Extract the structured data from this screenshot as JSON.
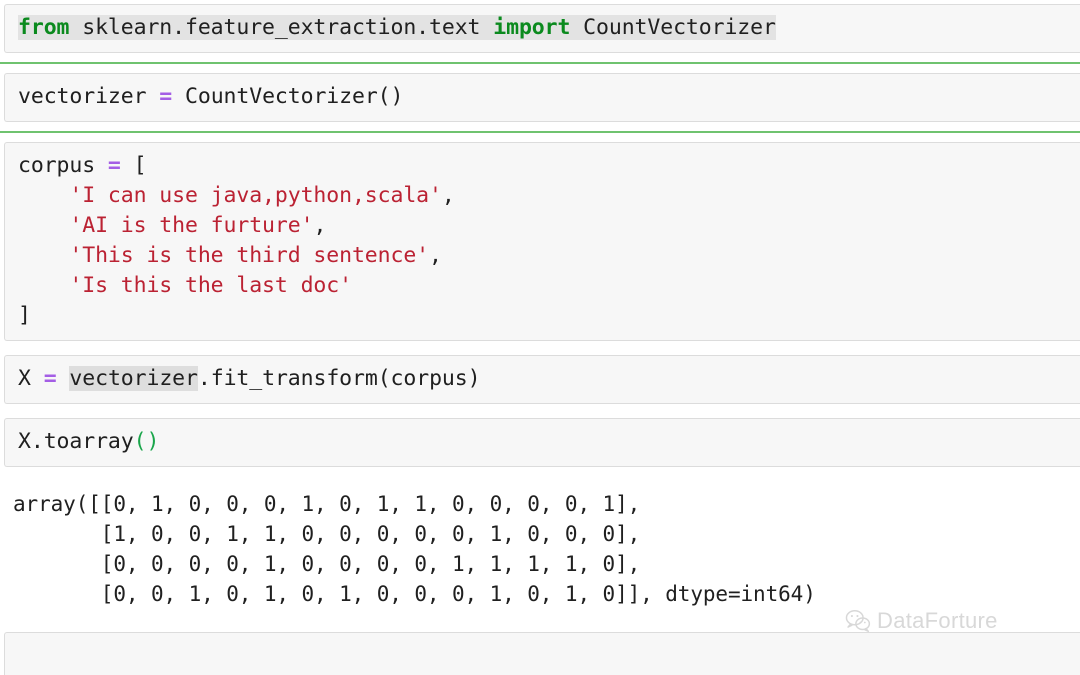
{
  "notebook": {
    "cells": [
      {
        "id": "cell-import",
        "type": "code",
        "highlighted_line": true,
        "tokens": [
          {
            "t": "from",
            "c": "kw"
          },
          {
            "t": " sklearn.feature_extraction.text ",
            "c": "plain"
          },
          {
            "t": "import",
            "c": "kw"
          },
          {
            "t": " CountVectorizer",
            "c": "plain"
          }
        ],
        "text": "from sklearn.feature_extraction.text import CountVectorizer"
      },
      {
        "id": "cell-vectorizer",
        "type": "code",
        "tokens": [
          {
            "t": "vectorizer ",
            "c": "plain"
          },
          {
            "t": "=",
            "c": "op"
          },
          {
            "t": " CountVectorizer()",
            "c": "plain"
          }
        ],
        "text": "vectorizer = CountVectorizer()"
      },
      {
        "id": "cell-corpus",
        "type": "code",
        "lines": [
          [
            {
              "t": "corpus ",
              "c": "plain"
            },
            {
              "t": "=",
              "c": "op"
            },
            {
              "t": " [",
              "c": "plain"
            }
          ],
          [
            {
              "t": "    ",
              "c": "plain"
            },
            {
              "t": "'I can use java,python,scala'",
              "c": "str"
            },
            {
              "t": ",",
              "c": "plain"
            }
          ],
          [
            {
              "t": "    ",
              "c": "plain"
            },
            {
              "t": "'AI is the furture'",
              "c": "str"
            },
            {
              "t": ",",
              "c": "plain"
            }
          ],
          [
            {
              "t": "    ",
              "c": "plain"
            },
            {
              "t": "'This is the third sentence'",
              "c": "str"
            },
            {
              "t": ",",
              "c": "plain"
            }
          ],
          [
            {
              "t": "    ",
              "c": "plain"
            },
            {
              "t": "'Is this the last doc'",
              "c": "str"
            }
          ],
          [
            {
              "t": "]",
              "c": "plain"
            }
          ]
        ],
        "text": "corpus = [\n    'I can use java,python,scala',\n    'AI is the furture',\n    'This is the third sentence',\n    'Is this the last doc'\n]"
      },
      {
        "id": "cell-fit-transform",
        "type": "code",
        "tokens": [
          {
            "t": "X ",
            "c": "plain"
          },
          {
            "t": "=",
            "c": "op"
          },
          {
            "t": " ",
            "c": "plain"
          },
          {
            "t": "vectorizer",
            "c": "hl"
          },
          {
            "t": ".fit_transform(corpus)",
            "c": "plain"
          }
        ],
        "text": "X = vectorizer.fit_transform(corpus)"
      },
      {
        "id": "cell-toarray",
        "type": "code",
        "tokens": [
          {
            "t": "X.toarray",
            "c": "plain"
          },
          {
            "t": "()",
            "c": "paren"
          }
        ],
        "text": "X.toarray()"
      }
    ],
    "separators_after_cell": [
      "cell-import",
      "cell-vectorizer"
    ],
    "output": {
      "id": "output-array",
      "prefix": "array([",
      "suffix": "], dtype=int64)",
      "dtype": "int64",
      "rows": [
        [
          0,
          1,
          0,
          0,
          0,
          1,
          0,
          1,
          1,
          0,
          0,
          0,
          0,
          1
        ],
        [
          1,
          0,
          0,
          1,
          1,
          0,
          0,
          0,
          0,
          0,
          1,
          0,
          0,
          0
        ],
        [
          0,
          0,
          0,
          0,
          1,
          0,
          0,
          0,
          0,
          1,
          1,
          1,
          1,
          0
        ],
        [
          0,
          0,
          1,
          0,
          1,
          0,
          1,
          0,
          0,
          0,
          1,
          0,
          1,
          0
        ]
      ],
      "lines": [
        "array([[0, 1, 0, 0, 0, 1, 0, 1, 1, 0, 0, 0, 0, 1],",
        "       [1, 0, 0, 1, 1, 0, 0, 0, 0, 0, 1, 0, 0, 0],",
        "       [0, 0, 0, 0, 1, 0, 0, 0, 0, 1, 1, 1, 1, 0],",
        "       [0, 0, 1, 0, 1, 0, 1, 0, 0, 0, 1, 0, 1, 0]], dtype=int64)"
      ]
    }
  },
  "watermark": {
    "text": "DataForture",
    "icon": "wechat-icon",
    "color": "#d8d8d8"
  },
  "colors": {
    "keyword": "#0b8a1e",
    "operator": "#a45ee5",
    "string": "#bb2233",
    "paren": "#19a54a",
    "highlight": "#dedede",
    "separator": "#6fc36f",
    "cell_bg": "#f7f7f7",
    "cell_border": "#dcdcdc"
  }
}
